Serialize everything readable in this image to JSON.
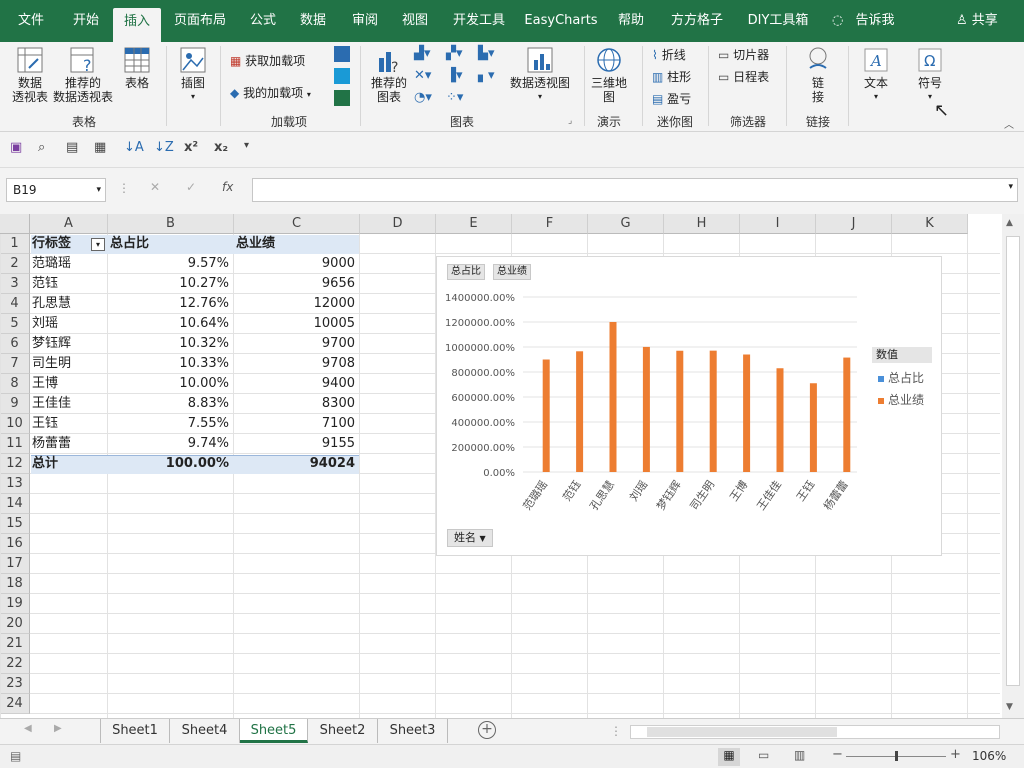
{
  "menu": {
    "tabs": [
      "文件",
      "开始",
      "插入",
      "页面布局",
      "公式",
      "数据",
      "审阅",
      "视图",
      "开发工具",
      "EasyCharts",
      "帮助",
      "方方格子",
      "DIY工具箱"
    ],
    "tell_me": "告诉我",
    "share": "共享"
  },
  "ribbon": {
    "pivot_table": "数据\n透视表",
    "recommended_pivot": "推荐的\n数据透视表",
    "table": "表格",
    "group_table": "表格",
    "illustrations": "插图",
    "get_addins": "获取加载项",
    "my_addins": "我的加载项",
    "group_addins": "加载项",
    "recommended_charts": "推荐的\n图表",
    "pivot_chart": "数据透视图",
    "group_charts": "图表",
    "map_3d": "三维地\n图",
    "group_tours": "演示",
    "spark_line": "折线",
    "spark_column": "柱形",
    "spark_winloss": "盈亏",
    "group_sparklines": "迷你图",
    "slicer": "切片器",
    "timeline": "日程表",
    "group_filters": "筛选器",
    "link": "链\n接",
    "group_links": "链接",
    "text": "文本",
    "symbols": "符号"
  },
  "formula": {
    "name_box": "B19",
    "fx": "fx",
    "value": ""
  },
  "columns": [
    "A",
    "B",
    "C",
    "D",
    "E",
    "F",
    "G",
    "H",
    "I",
    "J",
    "K"
  ],
  "rows": [
    "1",
    "2",
    "3",
    "4",
    "5",
    "6",
    "7",
    "8",
    "9",
    "10",
    "11",
    "12",
    "13",
    "14",
    "15",
    "16",
    "17",
    "18",
    "19",
    "20",
    "21",
    "22",
    "23",
    "24"
  ],
  "pivot": {
    "header": [
      "行标签",
      "总占比",
      "总业绩"
    ],
    "data": [
      [
        "范璐瑶",
        "9.57%",
        "9000"
      ],
      [
        "范钰",
        "10.27%",
        "9656"
      ],
      [
        "孔思慧",
        "12.76%",
        "12000"
      ],
      [
        "刘瑶",
        "10.64%",
        "10005"
      ],
      [
        "梦钰辉",
        "10.32%",
        "9700"
      ],
      [
        "司生明",
        "10.33%",
        "9708"
      ],
      [
        "王博",
        "10.00%",
        "9400"
      ],
      [
        "王佳佳",
        "8.83%",
        "8300"
      ],
      [
        "王钰",
        "7.55%",
        "7100"
      ],
      [
        "杨蕾蕾",
        "9.74%",
        "9155"
      ]
    ],
    "total": [
      "总计",
      "100.00%",
      "94024"
    ]
  },
  "chart_buttons": [
    "总占比",
    "总业绩"
  ],
  "axis_filter": "姓名",
  "chart_data": {
    "type": "bar",
    "categories": [
      "范璐瑶",
      "范钰",
      "孔思慧",
      "刘瑶",
      "梦钰辉",
      "司生明",
      "王博",
      "王佳佳",
      "王钰",
      "杨蕾蕾"
    ],
    "series": [
      {
        "name": "总占比",
        "values": [
          0.0957,
          0.1027,
          0.1276,
          0.1064,
          0.1032,
          0.1033,
          0.1,
          0.0883,
          0.0755,
          0.0974
        ],
        "color": "#4a90d9"
      },
      {
        "name": "总业绩",
        "values": [
          9000,
          9656,
          12000,
          10005,
          9700,
          9708,
          9400,
          8300,
          7100,
          9155
        ],
        "color": "#ed7d31"
      }
    ],
    "y_ticks": [
      "0.00%",
      "200000.00%",
      "400000.00%",
      "600000.00%",
      "800000.00%",
      "1000000.00%",
      "1200000.00%",
      "1400000.00%"
    ],
    "ylim": [
      0,
      14000
    ],
    "legend_title": "数值",
    "legend_position": "right",
    "grid": true
  },
  "sheets": [
    "Sheet1",
    "Sheet4",
    "Sheet5",
    "Sheet2",
    "Sheet3"
  ],
  "active_sheet": "Sheet5",
  "zoom": "106%",
  "colors": {
    "excel_green": "#217346",
    "bar_orange": "#ed7d31",
    "bar_blue": "#4a90d9",
    "pivot_header": "#dde8f5"
  }
}
